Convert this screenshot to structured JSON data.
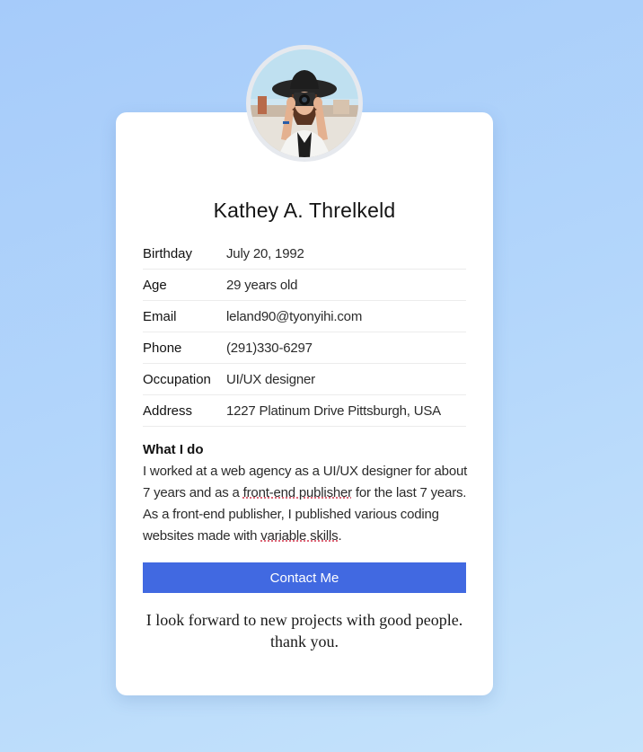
{
  "profile": {
    "name": "Kathey A. Threlkeld",
    "avatar_alt": "profile-photo"
  },
  "info": {
    "birthday": {
      "label": "Birthday",
      "value": "July 20, 1992"
    },
    "age": {
      "label": "Age",
      "value": "29 years old"
    },
    "email": {
      "label": "Email",
      "value": "leland90@tyonyihi.com"
    },
    "phone": {
      "label": "Phone",
      "value": "(291)330-6297"
    },
    "occupation": {
      "label": "Occupation",
      "value": "UI/UX designer"
    },
    "address": {
      "label": "Address",
      "value": "1227 Platinum Drive Pittsburgh, USA"
    }
  },
  "about": {
    "heading": "What I do",
    "text_1": "I worked at a web agency as a UI/UX designer for about 7 years and as a ",
    "link_1": "front-end publisher",
    "text_2": " for the last 7 years. As a front-end publisher, I published various coding websites made with ",
    "link_2": "variable skills",
    "text_3": "."
  },
  "contact_button": {
    "label": "Contact Me"
  },
  "footer": {
    "line_1": "I look forward to new projects with good people.",
    "line_2": "thank you."
  },
  "colors": {
    "accent": "#4169e1",
    "background_top": "#a6cbfa",
    "background_bottom": "#c5e3fb",
    "card": "#ffffff"
  }
}
